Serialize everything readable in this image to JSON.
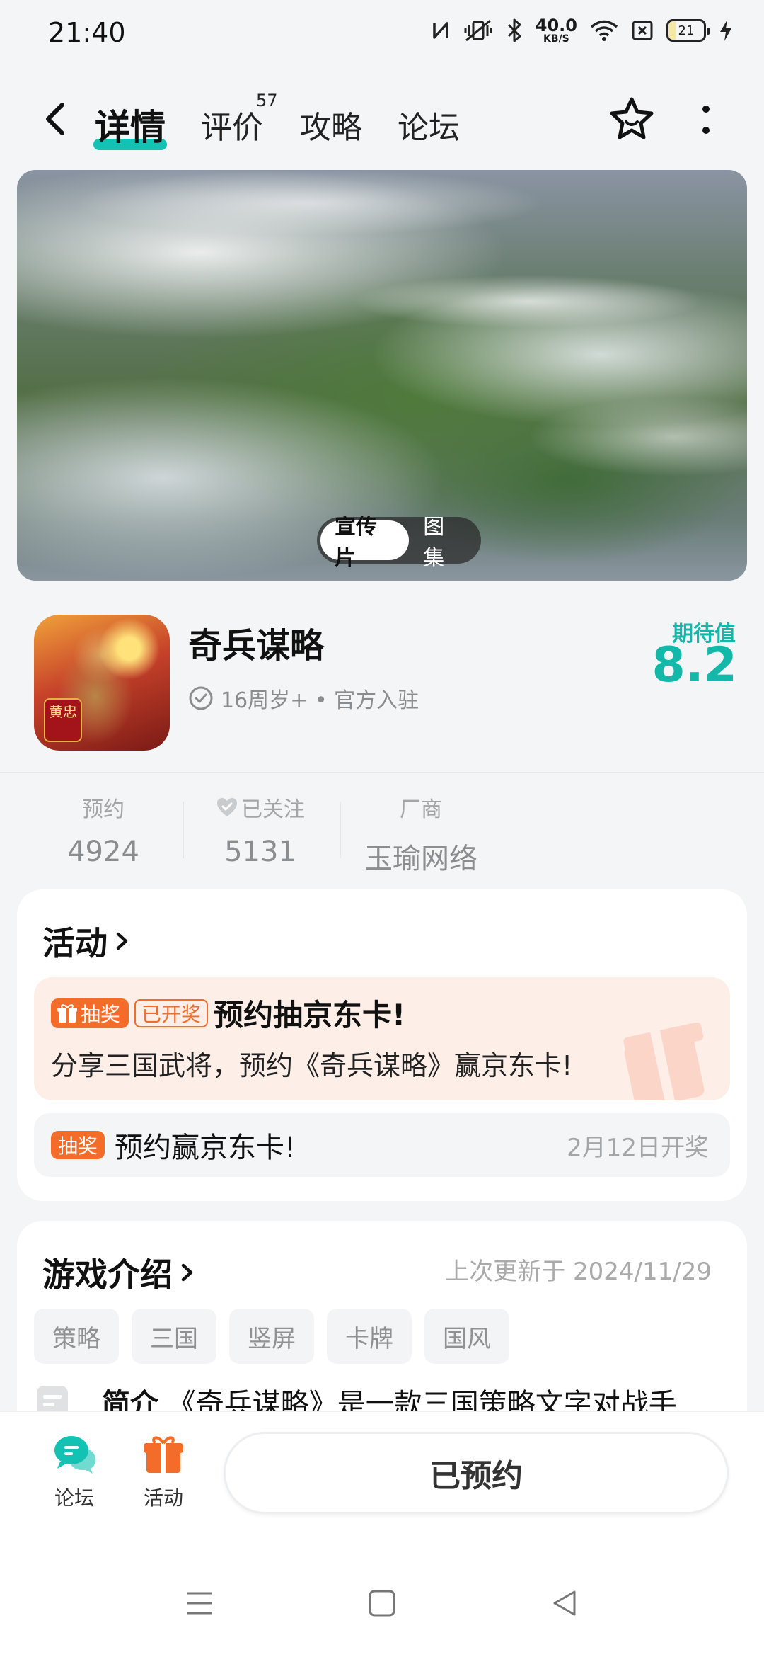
{
  "status_bar": {
    "time": "21:40",
    "net_speed_value": "40.0",
    "net_speed_unit": "KB/S",
    "battery": "21"
  },
  "nav": {
    "tabs": [
      {
        "label": "详情",
        "active": true
      },
      {
        "label": "评价",
        "badge": "57"
      },
      {
        "label": "攻略"
      },
      {
        "label": "论坛"
      }
    ]
  },
  "banner": {
    "options": [
      "宣传片",
      "图集"
    ],
    "selected": "宣传片"
  },
  "game": {
    "name": "奇兵谋略",
    "meta": "16周岁+ • 官方入驻",
    "icon_seal": "黄忠",
    "expect_label": "期待值",
    "expect_value": "8.2"
  },
  "stats": [
    {
      "label": "预约",
      "value": "4924"
    },
    {
      "label": "已关注",
      "value": "5131"
    },
    {
      "label": "厂商",
      "value": "玉瑜网络"
    }
  ],
  "activity": {
    "title": "活动",
    "promo": {
      "tag": "抽奖",
      "status": "已开奖",
      "title": "预约抽京东卡!",
      "desc": "分享三国武将，预约《奇兵谋略》赢京东卡!"
    },
    "lottery": {
      "tag": "抽奖",
      "text": "预约赢京东卡!",
      "date": "2月12日开奖"
    }
  },
  "intro": {
    "title": "游戏介绍",
    "updated": "上次更新于 2024/11/29",
    "tags": [
      "策略",
      "三国",
      "竖屏",
      "卡牌",
      "国风"
    ],
    "summary_label": "简介",
    "summary_text": "《奇兵谋略》是一款三国策略文字对战手"
  },
  "bottom_bar": {
    "forum": "论坛",
    "activity": "活动",
    "reserve_button": "已预约"
  },
  "colors": {
    "accent": "#13c2b3",
    "orange": "#f36c2a"
  }
}
